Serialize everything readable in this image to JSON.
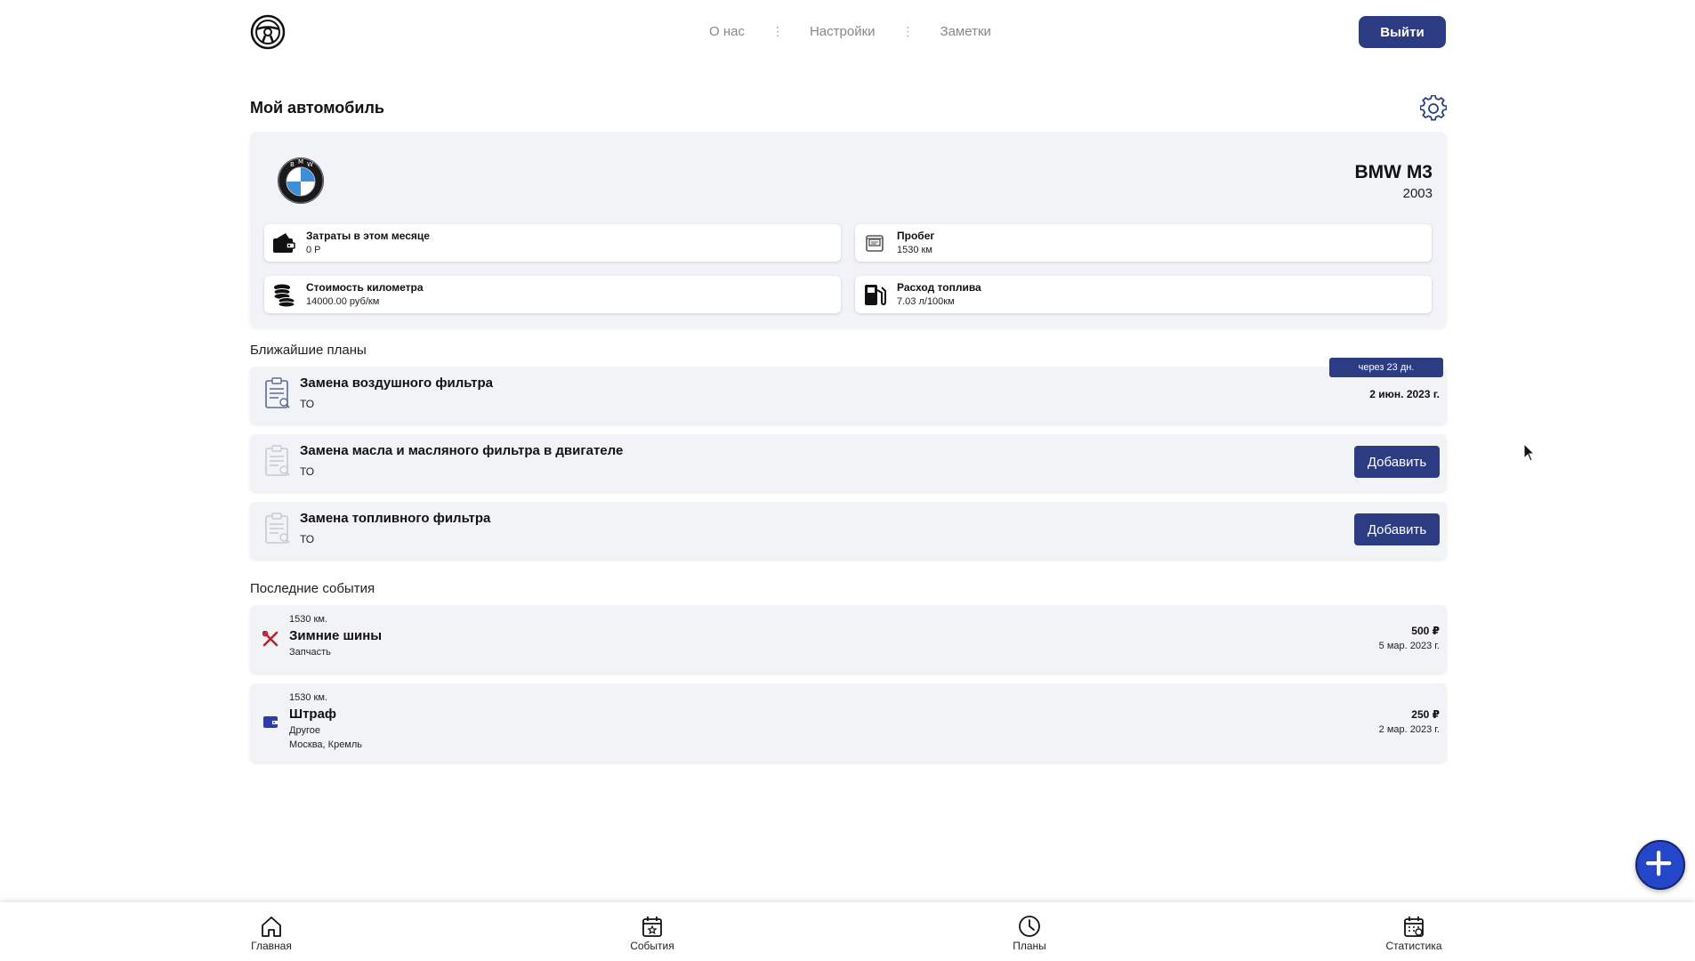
{
  "header": {
    "nav": [
      "О нас",
      "Настройки",
      "Заметки"
    ],
    "nav_separator": "⋮",
    "logout_label": "Выйти"
  },
  "car": {
    "section_title": "Мой автомобиль",
    "name": "BMW M3",
    "year": "2003",
    "stats": [
      {
        "label": "Затраты в этом месяце",
        "value": "0 Р",
        "icon": "wallet-icon"
      },
      {
        "label": "Пробег",
        "value": "1530 км",
        "icon": "odometer-icon"
      },
      {
        "label": "Стоимость километра",
        "value": "14000.00 руб/км",
        "icon": "coins-icon"
      },
      {
        "label": "Расход топлива",
        "value": "7.03 л/100км",
        "icon": "fuel-pump-icon"
      }
    ]
  },
  "plans": {
    "section_title": "Ближайшие планы",
    "items": [
      {
        "title": "Замена воздушного фильтра",
        "type": "ТО",
        "badge": "через 23 дн.",
        "date": "2 июн. 2023 г."
      },
      {
        "title": "Замена масла и масляного фильтра в двигателе",
        "type": "ТО",
        "button": "Добавить"
      },
      {
        "title": "Замена топливного фильтра",
        "type": "ТО",
        "button": "Добавить"
      }
    ]
  },
  "events": {
    "section_title": "Последние события",
    "items": [
      {
        "km": "1530 км.",
        "title": "Зимние шины",
        "category": "Запчасть",
        "amount": "500 ₽",
        "date": "5 мар. 2023 г.",
        "icon": "wrench-screwdriver-icon",
        "icon_color": "#b3262a"
      },
      {
        "km": "1530 км.",
        "title": "Штраф",
        "category": "Другое",
        "location": "Москва, Кремль",
        "amount": "250 ₽",
        "date": "2 мар. 2023 г.",
        "icon": "wallet-icon",
        "icon_color": "#2c3ca8"
      }
    ]
  },
  "bottom_nav": [
    {
      "label": "Главная",
      "icon": "home-icon"
    },
    {
      "label": "События",
      "icon": "calendar-star-icon"
    },
    {
      "label": "Планы",
      "icon": "clock-icon"
    },
    {
      "label": "Статистика",
      "icon": "calendar-stats-icon"
    }
  ],
  "colors": {
    "accent": "#2c3c82",
    "card_bg": "#f2f3f6",
    "fab": "#2446c8"
  }
}
